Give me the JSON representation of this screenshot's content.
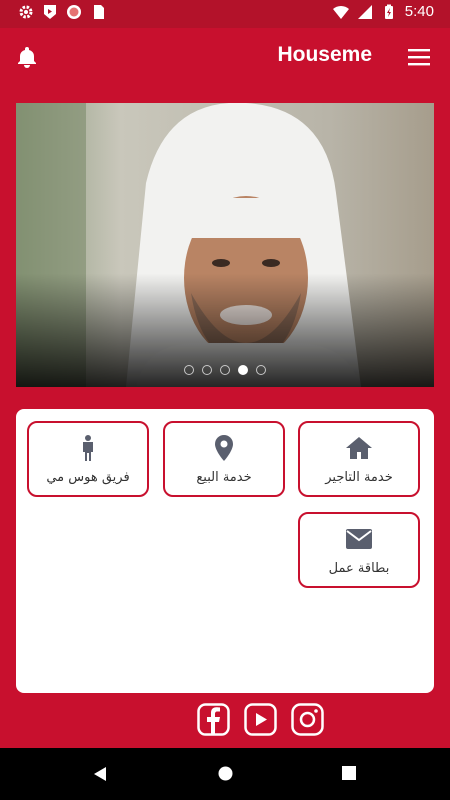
{
  "status_bar": {
    "time": "5:40"
  },
  "app_bar": {
    "title": "Houseme"
  },
  "carousel": {
    "slides": 5,
    "active_index": 3
  },
  "tiles": [
    {
      "label": "خدمة التاجير",
      "icon": "home-icon"
    },
    {
      "label": "خدمة البيع",
      "icon": "location-pin-icon"
    },
    {
      "label": "فريق هوس مي",
      "icon": "person-icon"
    },
    {
      "label": "بطاقة عمل",
      "icon": "envelope-icon"
    }
  ],
  "social": [
    "facebook-icon",
    "youtube-icon",
    "instagram-icon"
  ],
  "colors": {
    "primary": "#c8102e",
    "status_bar": "#b3122a",
    "icon_gray": "#5a5f6e"
  }
}
